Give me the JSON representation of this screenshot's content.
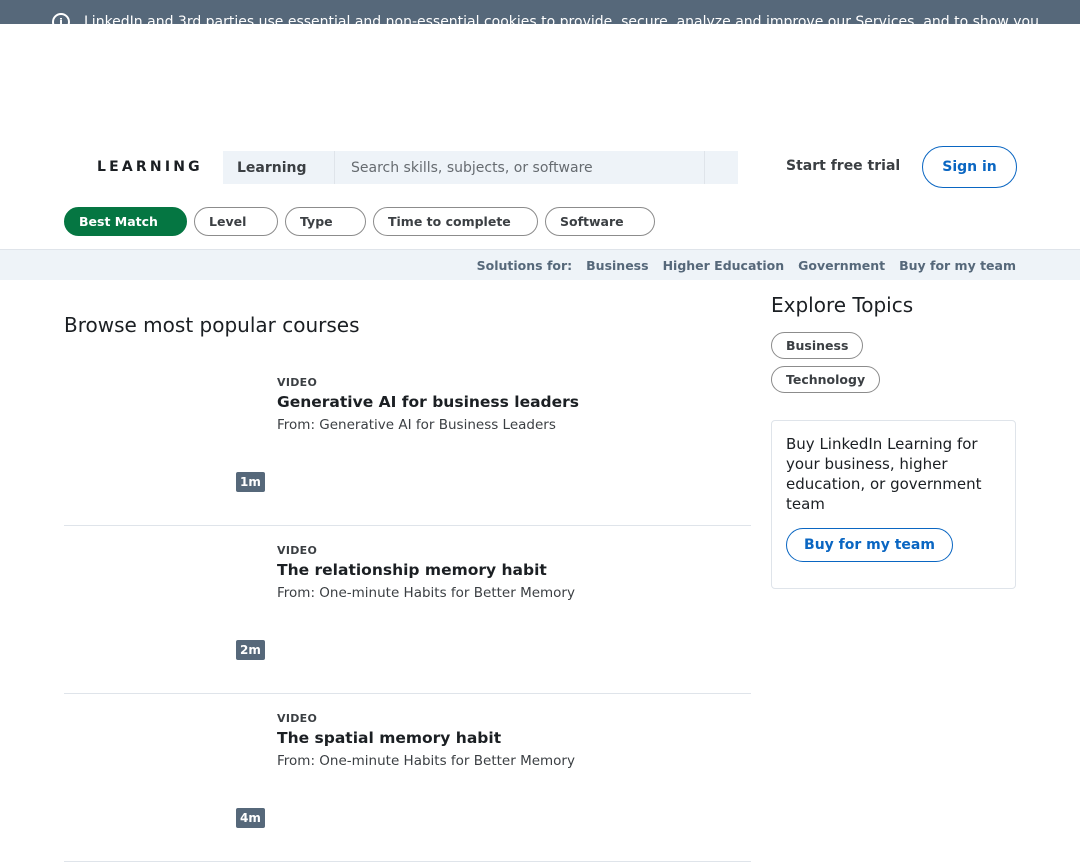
{
  "cookie_banner": {
    "text": "LinkedIn and 3rd parties use essential and non-essential cookies to provide, secure, analyze and improve our Services, and to show you"
  },
  "header": {
    "logo": "LEARNING",
    "search_scope": "Learning",
    "search_placeholder": "Search skills, subjects, or software",
    "start_trial": "Start free trial",
    "sign_in": "Sign in"
  },
  "filters": [
    "Best Match",
    "Level",
    "Type",
    "Time to complete",
    "Software"
  ],
  "solutions": {
    "label": "Solutions for:",
    "links": [
      "Business",
      "Higher Education",
      "Government",
      "Buy for my team"
    ]
  },
  "main": {
    "section_title": "Browse most popular courses",
    "courses": [
      {
        "type": "VIDEO",
        "title": "Generative AI for business leaders",
        "from": "From: Generative AI for Business Leaders",
        "duration": "1m"
      },
      {
        "type": "VIDEO",
        "title": "The relationship memory habit",
        "from": "From: One-minute Habits for Better Memory",
        "duration": "2m"
      },
      {
        "type": "VIDEO",
        "title": "The spatial memory habit",
        "from": "From: One-minute Habits for Better Memory",
        "duration": "4m"
      }
    ]
  },
  "sidebar": {
    "explore_title": "Explore Topics",
    "topics": [
      "Business",
      "Technology"
    ],
    "buy_text": "Buy LinkedIn Learning for your business, higher education, or government team",
    "buy_button": "Buy for my team"
  },
  "colors": {
    "accent_blue": "#0a66c2",
    "active_green": "#057642",
    "banner_gray": "#56687a",
    "search_bg": "#eef3f8"
  }
}
